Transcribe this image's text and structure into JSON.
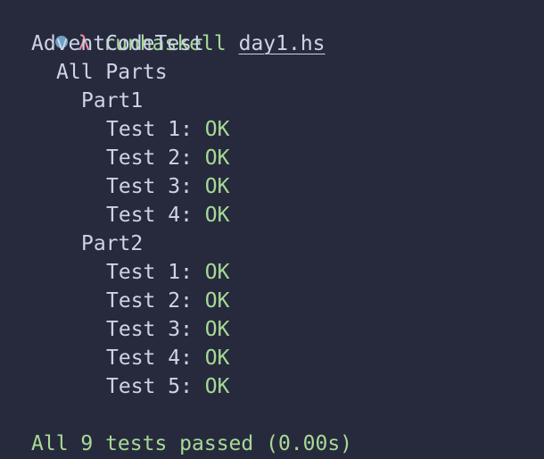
{
  "colors": {
    "background": "#272a3d",
    "text": "#cdd3e8",
    "success": "#a6da95",
    "prompt_lambda": "#f28b9f",
    "prompt_dot": "#6ca0c4"
  },
  "prompt": {
    "symbol": "λ",
    "command": "runhaskell",
    "argument": "day1.hs"
  },
  "output": {
    "suite": "AdventCodeTest",
    "group": "All Parts",
    "parts": [
      {
        "name": "Part1",
        "tests": [
          {
            "label": "Test 1:",
            "status": "OK"
          },
          {
            "label": "Test 2:",
            "status": "OK"
          },
          {
            "label": "Test 3:",
            "status": "OK"
          },
          {
            "label": "Test 4:",
            "status": "OK"
          }
        ]
      },
      {
        "name": "Part2",
        "tests": [
          {
            "label": "Test 1:",
            "status": "OK"
          },
          {
            "label": "Test 2:",
            "status": "OK"
          },
          {
            "label": "Test 3:",
            "status": "OK"
          },
          {
            "label": "Test 4:",
            "status": "OK"
          },
          {
            "label": "Test 5:",
            "status": "OK"
          }
        ]
      }
    ],
    "summary": "All 9 tests passed (0.00s)"
  }
}
